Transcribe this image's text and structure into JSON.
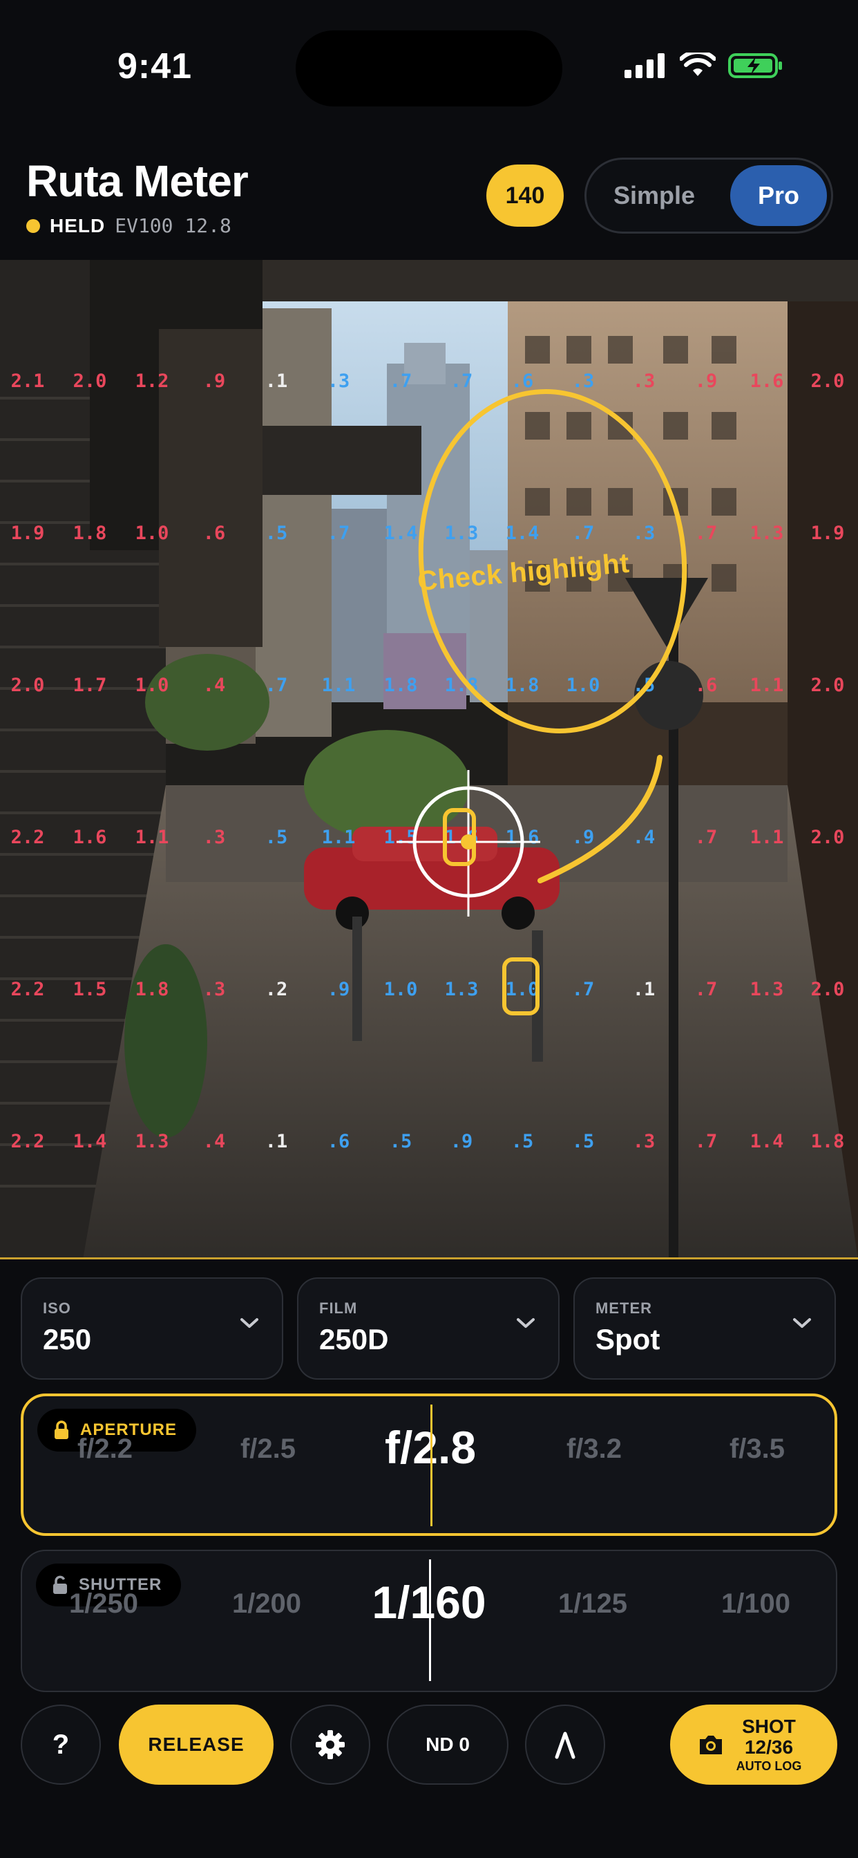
{
  "status_bar": {
    "time": "9:41"
  },
  "header": {
    "title": "Ruta Meter",
    "held_label": "HELD",
    "ev_text": "EV100 12.8",
    "badge": "140",
    "mode_options": [
      "Simple",
      "Pro"
    ],
    "selected_mode": "Pro"
  },
  "viewfinder": {
    "annotation": "Check highlight",
    "grid_rows": [
      [
        "2.1",
        "2.0",
        "1.2",
        ".9",
        ".1",
        ".3",
        ".7",
        ".7",
        ".6",
        ".3",
        ".3",
        ".9",
        "1.6",
        "2.0"
      ],
      [
        "1.9",
        "1.8",
        "1.0",
        ".6",
        ".5",
        ".7",
        "1.4",
        "1.3",
        "1.4",
        ".7",
        ".3",
        ".7",
        "1.3",
        "1.9"
      ],
      [
        "2.0",
        "1.7",
        "1.0",
        ".4",
        ".7",
        "1.1",
        "1.8",
        "1.8",
        "1.8",
        "1.0",
        ".5",
        ".6",
        "1.1",
        "2.0"
      ],
      [
        "2.2",
        "1.6",
        "1.1",
        ".3",
        ".5",
        "1.1",
        "1.5",
        "1.6",
        "1.6",
        ".9",
        ".4",
        ".7",
        "1.1",
        "2.0"
      ],
      [
        "2.2",
        "1.5",
        "1.8",
        ".3",
        ".2",
        ".9",
        "1.0",
        "1.3",
        "1.0",
        ".7",
        ".1",
        ".7",
        "1.3",
        "2.0"
      ],
      [
        "2.2",
        "1.4",
        "1.3",
        ".4",
        ".1",
        ".6",
        ".5",
        ".9",
        ".5",
        ".5",
        ".3",
        ".7",
        "1.4",
        "1.8"
      ]
    ],
    "grid_colors": [
      [
        "red",
        "red",
        "red",
        "red",
        "white",
        "blue",
        "blue",
        "blue",
        "blue",
        "blue",
        "red",
        "red",
        "red",
        "red"
      ],
      [
        "red",
        "red",
        "red",
        "red",
        "blue",
        "blue",
        "blue",
        "blue",
        "blue",
        "blue",
        "blue",
        "red",
        "red",
        "red"
      ],
      [
        "red",
        "red",
        "red",
        "red",
        "blue",
        "blue",
        "blue",
        "blue",
        "blue",
        "blue",
        "blue",
        "red",
        "red",
        "red"
      ],
      [
        "red",
        "red",
        "red",
        "red",
        "blue",
        "blue",
        "blue",
        "blue",
        "blue",
        "blue",
        "blue",
        "red",
        "red",
        "red"
      ],
      [
        "red",
        "red",
        "red",
        "red",
        "white",
        "blue",
        "blue",
        "blue",
        "blue",
        "blue",
        "white",
        "red",
        "red",
        "red"
      ],
      [
        "red",
        "red",
        "red",
        "red",
        "white",
        "blue",
        "blue",
        "blue",
        "blue",
        "blue",
        "red",
        "red",
        "red",
        "red"
      ]
    ]
  },
  "selectors": [
    {
      "label": "ISO",
      "value": "250"
    },
    {
      "label": "FILM",
      "value": "250D"
    },
    {
      "label": "METER",
      "value": "Spot"
    }
  ],
  "aperture": {
    "label": "APERTURE",
    "stops": [
      "f/2.2",
      "f/2.5",
      "f/2.8",
      "f/3.2",
      "f/3.5"
    ],
    "current": "f/2.8",
    "locked": true
  },
  "shutter": {
    "label": "SHUTTER",
    "stops": [
      "1/250",
      "1/200",
      "1/160",
      "1/125",
      "1/100"
    ],
    "current": "1/160",
    "locked": false
  },
  "bottom_bar": {
    "help": "?",
    "release": "RELEASE",
    "nd": "ND 0",
    "shot_label": "SHOT",
    "shot_count": "12/36",
    "shot_sub": "AUTO LOG"
  },
  "colors": {
    "accent": "#f7c531",
    "pro_blue": "#2b5fae",
    "over": "#e9475c",
    "under": "#3ea0f0"
  }
}
